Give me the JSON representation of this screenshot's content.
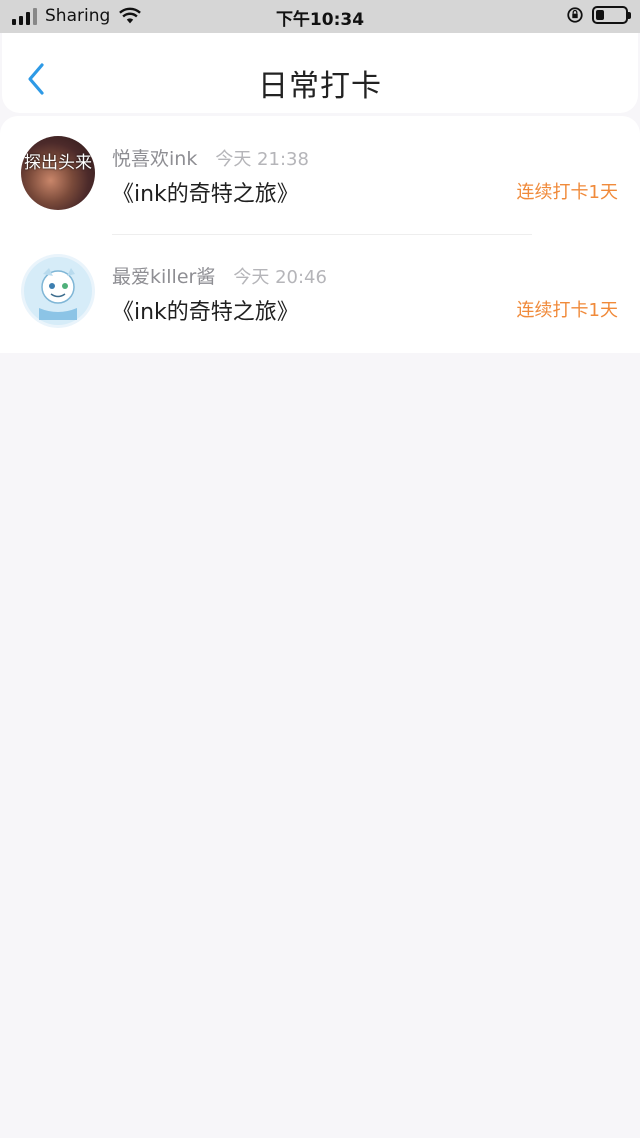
{
  "status_bar": {
    "carrier": "Sharing",
    "time": "下午10:34"
  },
  "nav": {
    "title": "日常打卡"
  },
  "checkins": [
    {
      "user": "悦喜欢ink",
      "time": "今天 21:38",
      "book": "《ink的奇特之旅》",
      "streak": "连续打卡1天",
      "avatar_text": "探出头来"
    },
    {
      "user": "最爱killer酱",
      "time": "今天 20:46",
      "book": "《ink的奇特之旅》",
      "streak": "连续打卡1天"
    }
  ],
  "colors": {
    "accent_orange": "#f08a3a",
    "back_blue": "#2e9ae6",
    "status_bar_bg": "#d6d6d6",
    "page_bg": "#f7f6f9"
  },
  "icons": {
    "back": "chevron-left-icon",
    "wifi": "wifi-icon",
    "rotation_lock": "rotation-lock-icon",
    "battery": "battery-icon",
    "signal": "signal-icon"
  }
}
